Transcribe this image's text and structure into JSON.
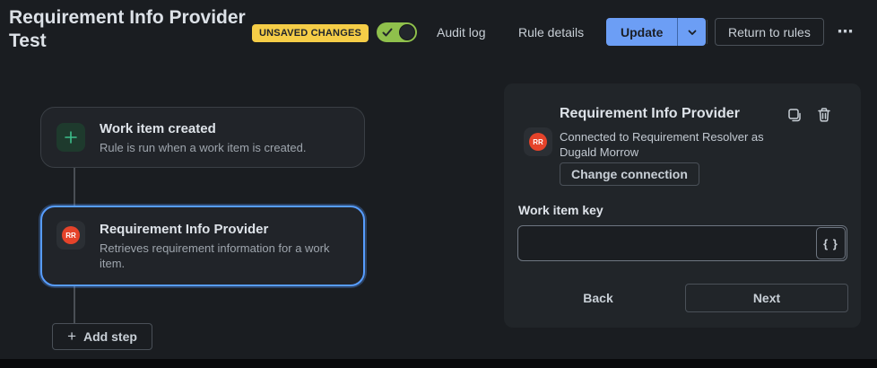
{
  "header": {
    "title": "Requirement Info Provider Test",
    "badge": "UNSAVED CHANGES",
    "toggle": {
      "state": "on",
      "icon": "check-icon"
    },
    "nav": [
      {
        "label": "Audit log"
      },
      {
        "label": "Rule details"
      }
    ],
    "update_label": "Update",
    "return_label": "Return to rules",
    "more_icon": "⋯"
  },
  "canvas": {
    "steps": [
      {
        "title": "Work item created",
        "description": "Rule is run when a work item is created.",
        "icon": "plus-icon",
        "selected": false
      },
      {
        "title": "Requirement Info Provider",
        "description": "Retrieves requirement information for a work item.",
        "icon": "rr-app-icon",
        "icon_text": "RR",
        "selected": true
      }
    ],
    "add_step": {
      "label": "Add step",
      "icon": "+"
    }
  },
  "panel": {
    "title": "Requirement Info Provider",
    "app_icon_text": "RR",
    "connection_text": "Connected to Requirement Resolver as\nDugald Morrow",
    "change_connection_label": "Change connection",
    "field": {
      "label": "Work item key",
      "value": "",
      "placeholder": ""
    },
    "smart_value_button": "{ }",
    "back_label": "Back",
    "next_label": "Next"
  },
  "colors": {
    "background": "#1A1D21",
    "surface": "#212529",
    "accent_blue": "#6C9EF5",
    "selection_blue": "#579DFF",
    "badge_yellow": "#F5CD47",
    "toggle_green": "#8FC04C",
    "app_icon_red": "#E5432A",
    "trigger_green": "#3DBE8B"
  }
}
